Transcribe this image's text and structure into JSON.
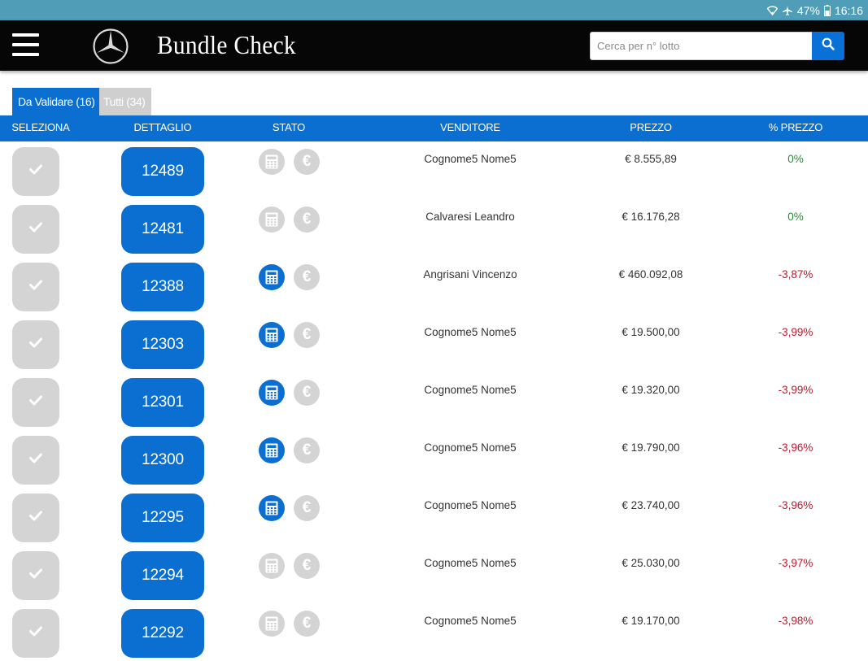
{
  "status_bar": {
    "battery": "47%",
    "time": "16:16"
  },
  "header": {
    "title": "Bundle Check",
    "search_placeholder": "Cerca per n° lotto"
  },
  "tabs": [
    {
      "label": "Da Validare (16)",
      "active": true
    },
    {
      "label": "Tutti (34)",
      "active": false
    }
  ],
  "table": {
    "columns": {
      "seleziona": "SELEZIONA",
      "dettaglio": "DETTAGLIO",
      "stato": "STATO",
      "venditore": "VENDITORE",
      "prezzo": "PREZZO",
      "pct_prezzo": "% PREZZO"
    },
    "rows": [
      {
        "lotto": "12489",
        "calc_state": "inactive",
        "euro_state": "inactive",
        "venditore": "Cognome5 Nome5",
        "prezzo": "€ 8.555,89",
        "pct": "0%",
        "pct_tone": "zero"
      },
      {
        "lotto": "12481",
        "calc_state": "inactive",
        "euro_state": "inactive",
        "venditore": "Calvaresi Leandro",
        "prezzo": "€ 16.176,28",
        "pct": "0%",
        "pct_tone": "zero"
      },
      {
        "lotto": "12388",
        "calc_state": "active",
        "euro_state": "inactive",
        "venditore": "Angrisani Vincenzo",
        "prezzo": "€ 460.092,08",
        "pct": "-3,87%",
        "pct_tone": "neg"
      },
      {
        "lotto": "12303",
        "calc_state": "active",
        "euro_state": "inactive",
        "venditore": "Cognome5 Nome5",
        "prezzo": "€ 19.500,00",
        "pct": "-3,99%",
        "pct_tone": "neg"
      },
      {
        "lotto": "12301",
        "calc_state": "active",
        "euro_state": "inactive",
        "venditore": "Cognome5 Nome5",
        "prezzo": "€ 19.320,00",
        "pct": "-3,99%",
        "pct_tone": "neg"
      },
      {
        "lotto": "12300",
        "calc_state": "active",
        "euro_state": "inactive",
        "venditore": "Cognome5 Nome5",
        "prezzo": "€ 19.790,00",
        "pct": "-3,96%",
        "pct_tone": "neg"
      },
      {
        "lotto": "12295",
        "calc_state": "active",
        "euro_state": "inactive",
        "venditore": "Cognome5 Nome5",
        "prezzo": "€ 23.740,00",
        "pct": "-3,96%",
        "pct_tone": "neg"
      },
      {
        "lotto": "12294",
        "calc_state": "inactive",
        "euro_state": "inactive",
        "venditore": "Cognome5 Nome5",
        "prezzo": "€ 25.030,00",
        "pct": "-3,97%",
        "pct_tone": "neg"
      },
      {
        "lotto": "12292",
        "calc_state": "inactive",
        "euro_state": "inactive",
        "venditore": "Cognome5 Nome5",
        "prezzo": "€ 19.170,00",
        "pct": "-3,98%",
        "pct_tone": "neg"
      }
    ]
  },
  "icons": {
    "status_bar": [
      "wifi-icon",
      "airplane-icon",
      "battery-icon"
    ],
    "header": [
      "menu-icon",
      "mercedes-logo-icon",
      "search-icon"
    ],
    "row": [
      "check-icon",
      "calculator-icon",
      "euro-icon"
    ]
  },
  "colors": {
    "accent_blue": "#0a6fd0",
    "status_bar": "#4f9db6",
    "app_bar": "#060606",
    "inactive_grey": "#d4d4d4",
    "positive_green": "#2c8a3a",
    "negative_red": "#c0182b"
  }
}
